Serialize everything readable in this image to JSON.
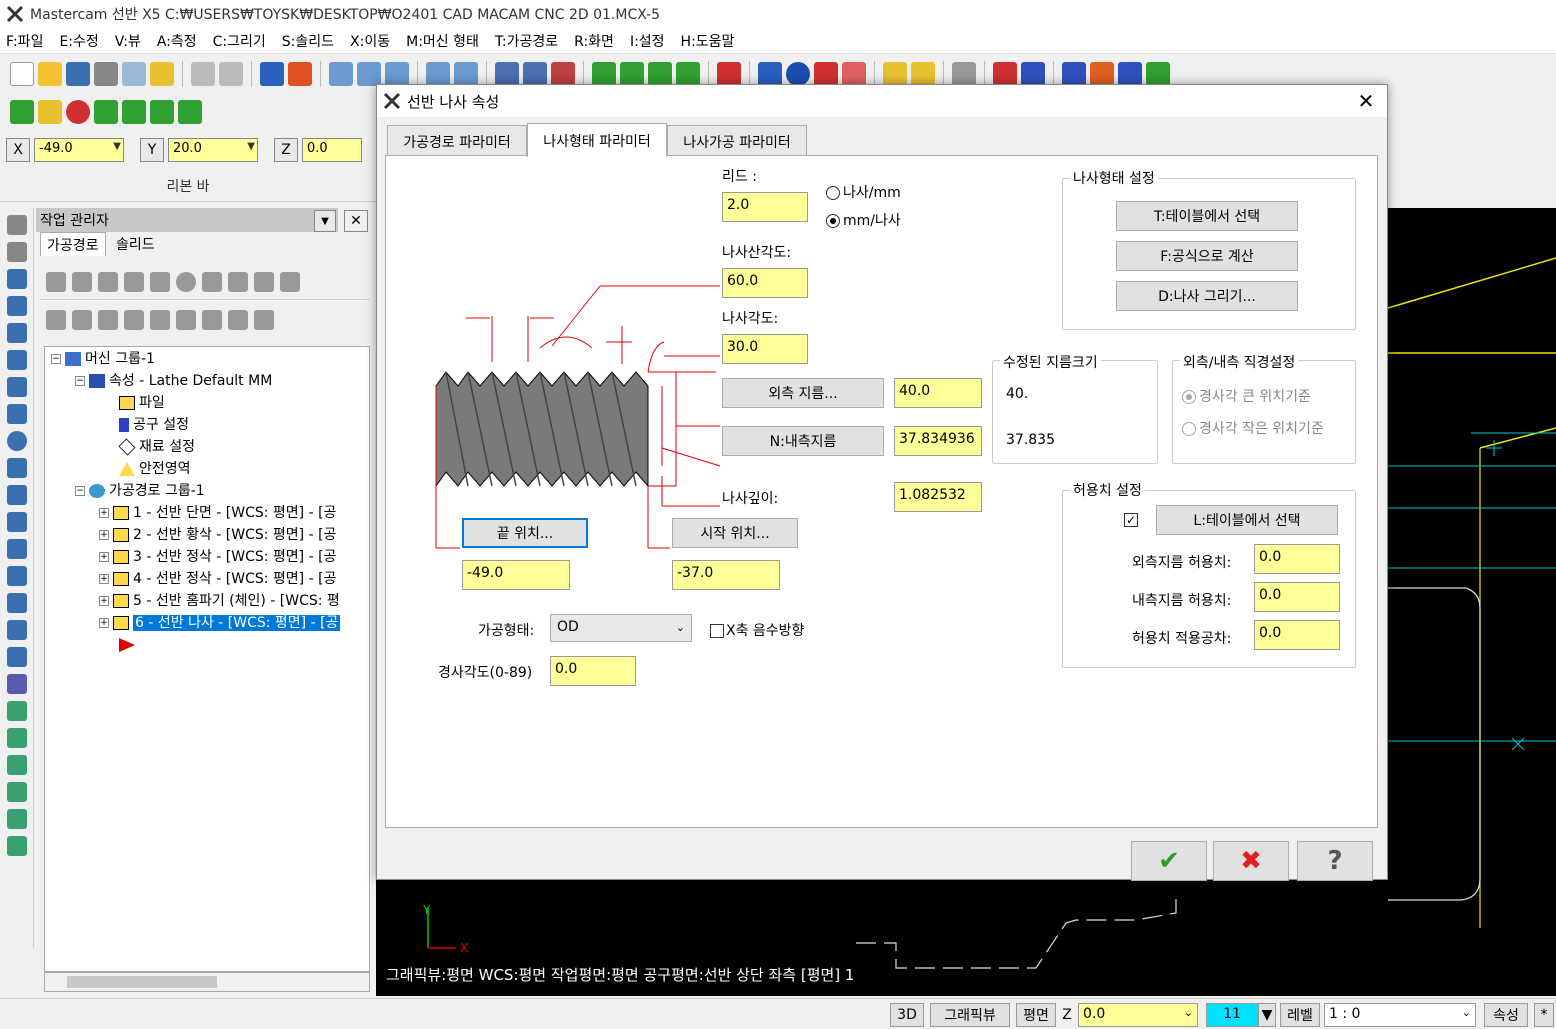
{
  "app": {
    "title": "Mastercam 선반 X5  C:₩USERS₩TOYSK₩DESKTOP₩O2401 CAD MACAM CNC 2D 01.MCX-5"
  },
  "menu": [
    "F:파일",
    "E:수정",
    "V:뷰",
    "A:측정",
    "C:그리기",
    "S:솔리드",
    "X:이동",
    "M:머신 형태",
    "T:가공경로",
    "R:화면",
    "I:설정",
    "H:도움말"
  ],
  "coords": {
    "x_label": "X",
    "x_value": "-49.0",
    "y_label": "Y",
    "y_value": "20.0",
    "z_label": "Z",
    "z_value": "0.0"
  },
  "ribbon_label": "리본 바",
  "ops_manager": {
    "title": "작업 관리자",
    "close": "✕",
    "tabs": [
      "가공경로",
      "솔리드"
    ],
    "tree": {
      "machine_group": "머신 그룹-1",
      "properties": "속성 - Lathe Default MM",
      "files": "파일",
      "tool_settings": "공구 설정",
      "stock_settings": "재료 설정",
      "safety_zone": "안전영역",
      "toolpath_group": "가공경로 그룹-1",
      "ops": [
        "1 - 선반 단면 - [WCS: 평면] - [공",
        "2 - 선반 황삭 - [WCS: 평면] - [공",
        "3 - 선반 정삭 - [WCS: 평면] - [공",
        "4 - 선반 정삭 - [WCS: 평면] - [공",
        "5 - 선반 홈파기 (체인) - [WCS: 평",
        "6 - 선반 나사 - [WCS: 평면] - [공"
      ]
    }
  },
  "gfx_status": "그래픽뷰:평면   WCS:평면   작업평면:평면   공구평면:선반 상단 좌측 [평면] 1",
  "bottom": {
    "btn_3d": "3D",
    "btn_graphicview": "그래픽뷰",
    "btn_plane": "평면",
    "z_label": "Z",
    "z_value": "0.0",
    "color_value": "11",
    "level_label": "레벨",
    "level_value": "1 : 0",
    "attr_button": "속성",
    "last": "*"
  },
  "dialog": {
    "title": "선반 나사 속성",
    "close": "✕",
    "tabs": [
      "가공경로 파라미터",
      "나사형태 파라미터",
      "나사가공 파라미터"
    ],
    "lead_label": "리드 :",
    "lead_value": "2.0",
    "radio_per_mm": "나사/mm",
    "radio_mm_per": "mm/나사",
    "included_angle_label": "나사산각도:",
    "included_angle_value": "60.0",
    "thread_angle_label": "나사각도:",
    "thread_angle_value": "30.0",
    "major_dia_button": "외측 지름...",
    "major_dia_value": "40.0",
    "minor_dia_button": "N:내측지름",
    "minor_dia_value": "37.834936",
    "depth_label": "나사깊이:",
    "depth_value": "1.082532",
    "end_pos_button": "끝 위치...",
    "end_pos_value": "-49.0",
    "start_pos_button": "시작 위치...",
    "start_pos_value": "-37.0",
    "thread_type_label": "가공형태:",
    "thread_type_value": "OD",
    "neg_x_checkbox": "X축 음수방향",
    "taper_label": "경사각도(0-89)",
    "taper_value": "0.0",
    "form_group": {
      "title": "나사형태 설정",
      "table_button": "T:테이블에서 선택",
      "formula_button": "F:공식으로 계산",
      "draw_button": "D:나사 그리기..."
    },
    "adjusted_group": {
      "title": "수정된 지름크기",
      "major": "40.",
      "minor": "37.835"
    },
    "dia_group": {
      "title": "외측/내측 직경설정",
      "opt_large": "경사각 큰 위치기준",
      "opt_small": "경사각 작은 위치기준"
    },
    "tol_group": {
      "title": "허용치 설정",
      "table_button": "L:테이블에서 선택",
      "major_tol_label": "외측지름 허용치:",
      "major_tol_value": "0.0",
      "minor_tol_label": "내측지름 허용치:",
      "minor_tol_value": "0.0",
      "apply_tol_label": "허용치 적용공차:",
      "apply_tol_value": "0.0"
    },
    "ok": "✔",
    "cancel": "✖",
    "help": "?"
  }
}
